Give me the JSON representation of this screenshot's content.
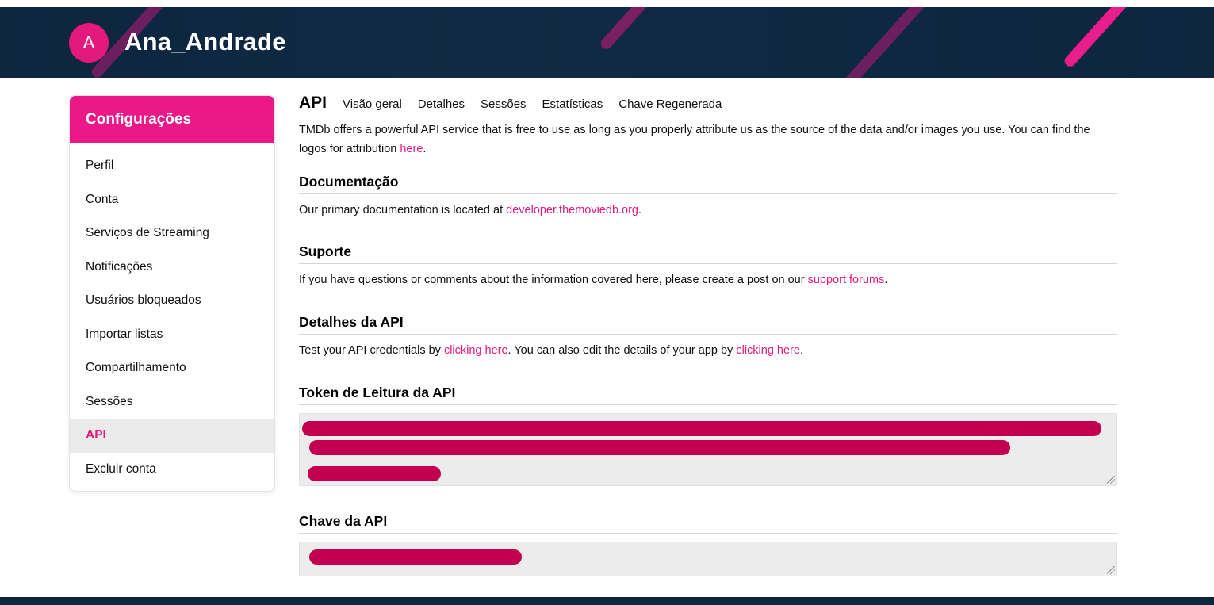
{
  "colors": {
    "header_bg": "#0d253f",
    "accent": "#e3197e",
    "sidebar_head": "#ea1987",
    "redaction": "#c2004f"
  },
  "header": {
    "avatar_letter": "A",
    "username": "Ana_Andrade"
  },
  "sidebar": {
    "title": "Configurações",
    "items": [
      {
        "label": "Perfil"
      },
      {
        "label": "Conta"
      },
      {
        "label": "Serviços de Streaming"
      },
      {
        "label": "Notificações"
      },
      {
        "label": "Usuários bloqueados"
      },
      {
        "label": "Importar listas"
      },
      {
        "label": "Compartilhamento"
      },
      {
        "label": "Sessões"
      },
      {
        "label": "API",
        "active": true
      },
      {
        "label": "Excluir conta"
      }
    ]
  },
  "main": {
    "title": "API",
    "tabs": [
      "Visão geral",
      "Detalhes",
      "Sessões",
      "Estatísticas",
      "Chave Regenerada"
    ],
    "intro": {
      "text": "TMDb offers a powerful API service that is free to use as long as you properly attribute us as the source of the data and/or images you use. You can find the logos for attribution ",
      "link": "here",
      "end": "."
    },
    "documentation": {
      "heading": "Documentação",
      "text": "Our primary documentation is located at ",
      "link": "developer.themoviedb.org",
      "end": "."
    },
    "support": {
      "heading": "Suporte",
      "text": "If you have questions or comments about the information covered here, please create a post on our ",
      "link": "support forums",
      "end": "."
    },
    "api_details": {
      "heading": "Detalhes da API",
      "text1": "Test your API credentials by ",
      "link1": "clicking here",
      "text2": ". You can also edit the details of your app by ",
      "link2": "clicking here",
      "end": "."
    },
    "read_token": {
      "heading": "Token de Leitura da API"
    },
    "api_key": {
      "heading": "Chave da API"
    }
  }
}
